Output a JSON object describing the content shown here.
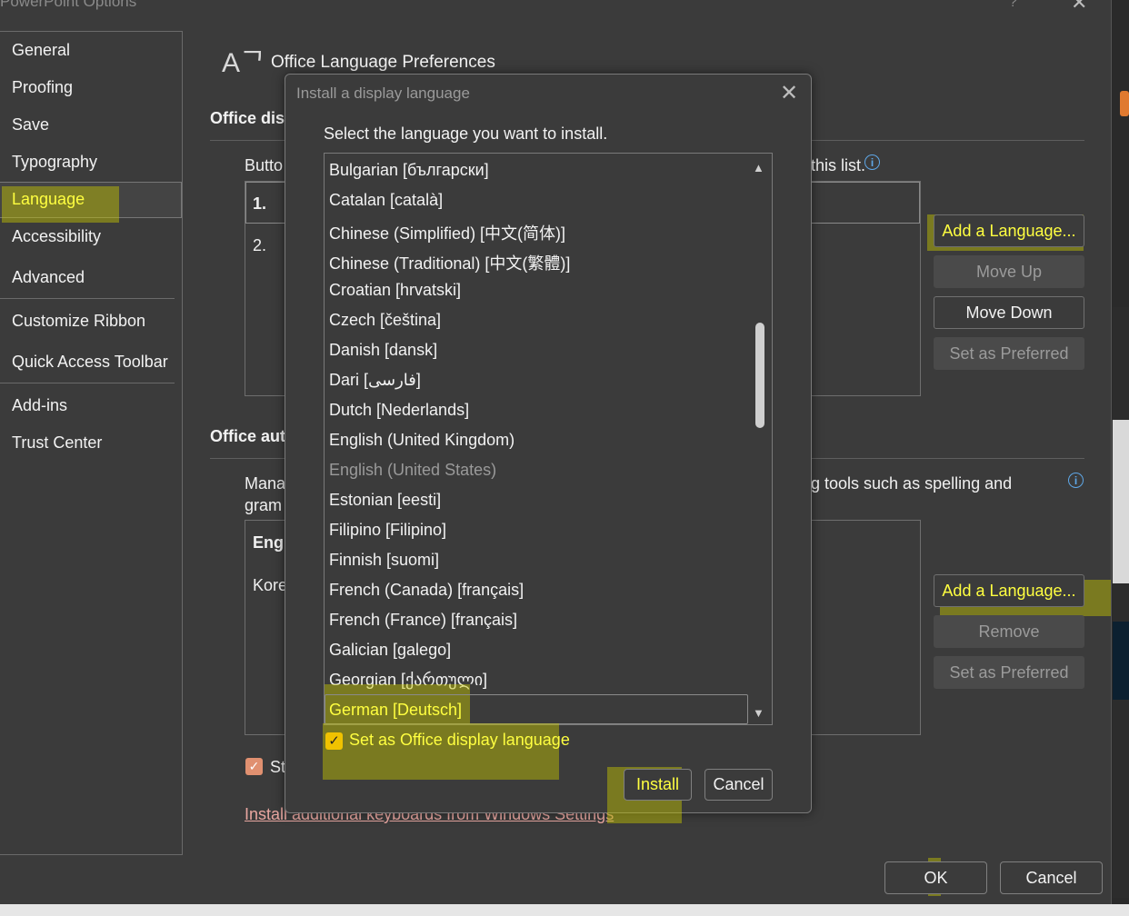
{
  "window": {
    "title": "PowerPoint Options",
    "help": "?",
    "close": "✕"
  },
  "nav": {
    "items": [
      "General",
      "Proofing",
      "Save",
      "Typography",
      "Language",
      "Accessibility",
      "Advanced",
      "Customize Ribbon",
      "Quick Access Toolbar",
      "Add-ins",
      "Trust Center"
    ],
    "selected": "Language"
  },
  "main": {
    "header_icon": "Aᄀ",
    "header_title": "Office Language Preferences",
    "display_section": {
      "title": "Office dis",
      "desc_left": "Butto",
      "desc_right": "this list.",
      "list_1": "1.",
      "list_2": "2."
    },
    "display_buttons": {
      "add": "Add a Language...",
      "up": "Move Up",
      "down": "Move Down",
      "preferred": "Set as Preferred"
    },
    "authoring_section": {
      "title": "Office aut",
      "desc_left1": "Mana",
      "desc_left2": "gram",
      "desc_right": "g tools such as spelling and",
      "item1": "Engl",
      "item2": "Kore"
    },
    "authoring_buttons": {
      "add": "Add a Language...",
      "remove": "Remove",
      "preferred": "Set as Preferred"
    },
    "st_label": "St",
    "link": "Install additional keyboards from Windows Settings"
  },
  "footer": {
    "ok": "OK",
    "cancel": "Cancel"
  },
  "dialog": {
    "title": "Install a display language",
    "close": "✕",
    "prompt": "Select the language you want to install.",
    "languages": [
      "Bulgarian [български]",
      "Catalan [català]",
      "Chinese (Simplified) [中文(简体)]",
      "Chinese (Traditional) [中文(繁體)]",
      "Croatian [hrvatski]",
      "Czech [čeština]",
      "Danish [dansk]",
      "Dari [فارسی]",
      "Dutch [Nederlands]",
      "English (United Kingdom)",
      "English (United States)",
      "Estonian [eesti]",
      "Filipino [Filipino]",
      "Finnish [suomi]",
      "French (Canada) [français]",
      "French (France) [français]",
      "Galician [galego]",
      "Georgian [ქართული]",
      "German [Deutsch]"
    ],
    "disabled_language": "English (United States)",
    "selected_language": "German [Deutsch]",
    "checkbox_label": "Set as Office display language",
    "checkbox_checked": true,
    "install": "Install",
    "cancel": "Cancel"
  },
  "colors": {
    "highlight": "#c8c800",
    "checkbox": "#f0c200",
    "link": "#e8a6a0",
    "info": "#5fa8e8"
  }
}
